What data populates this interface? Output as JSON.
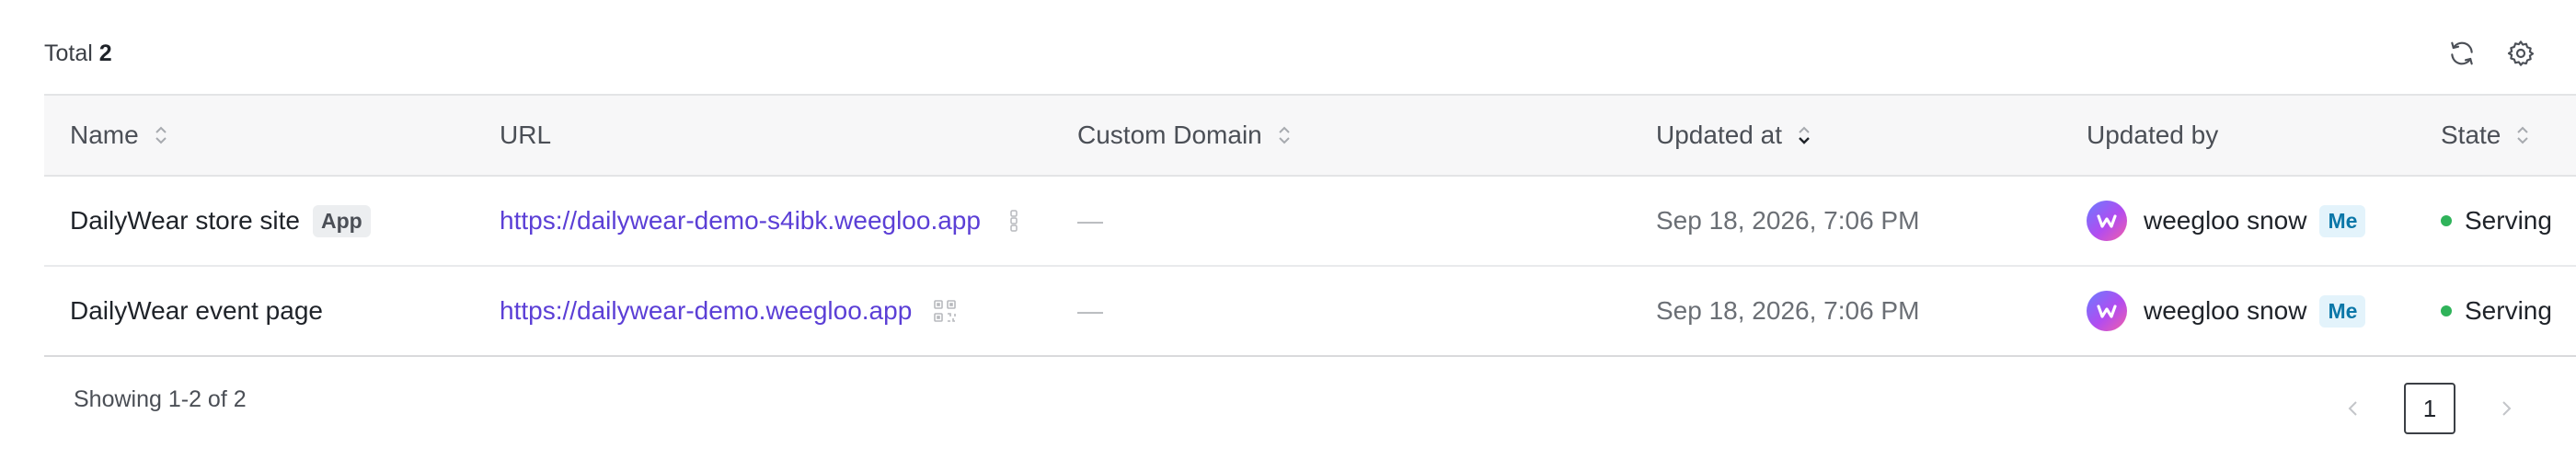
{
  "toolbar": {
    "total_label": "Total",
    "total_count": "2",
    "refresh_icon": "refresh-icon",
    "settings_icon": "gear-icon"
  },
  "table": {
    "columns": [
      {
        "label": "Name",
        "sortable": true
      },
      {
        "label": "URL",
        "sortable": false
      },
      {
        "label": "Custom Domain",
        "sortable": true
      },
      {
        "label": "Updated at",
        "sortable": true,
        "sort_active": "desc"
      },
      {
        "label": "Updated by",
        "sortable": false
      },
      {
        "label": "State",
        "sortable": true
      }
    ],
    "rows": [
      {
        "name": "DailyWear store site",
        "badge": "App",
        "url": "https://dailywear-demo-s4ibk.weegloo.app",
        "url_icon": "more-vertical-icon",
        "custom_domain": "—",
        "updated_at": "Sep 18, 2026, 7:06 PM",
        "updated_by": "weegloo snow",
        "me_badge": "Me",
        "state": "Serving"
      },
      {
        "name": "DailyWear event page",
        "url": "https://dailywear-demo.weegloo.app",
        "url_icon": "qr-code-icon",
        "custom_domain": "—",
        "updated_at": "Sep 18, 2026, 7:06 PM",
        "updated_by": "weegloo snow",
        "me_badge": "Me",
        "state": "Serving"
      }
    ]
  },
  "footer": {
    "showing": "Showing 1-2 of 2",
    "current_page": "1"
  },
  "colors": {
    "link": "#5b3fd6",
    "serving": "#2fb35a",
    "me_badge_bg": "#e3f3fb",
    "me_badge_text": "#0b77a8"
  }
}
